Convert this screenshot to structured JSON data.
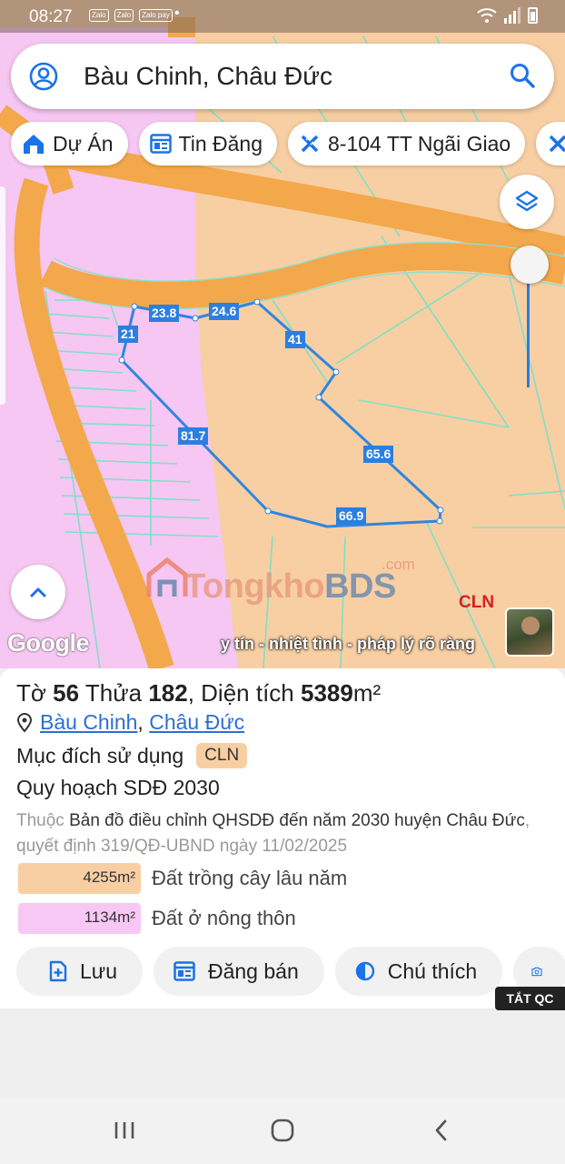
{
  "status_bar": {
    "time": "08:27",
    "app_icons": [
      "Zalo",
      "Zalo",
      "Zalo pay"
    ]
  },
  "search": {
    "value": "Bàu Chinh, Châu Đức",
    "placeholder": ""
  },
  "chips": [
    {
      "label": "Dự Án",
      "icon": "home-icon"
    },
    {
      "label": "Tin Đăng",
      "icon": "news-icon"
    },
    {
      "label": "8-104 TT Ngãi Giao",
      "icon": "tools-icon"
    }
  ],
  "map": {
    "dimensions": [
      "23.8",
      "24.6",
      "21",
      "41",
      "81.7",
      "65.6",
      "66.9"
    ],
    "zone_label": "CLN",
    "watermark": {
      "brand_orange": "Tongkho",
      "brand_blue": "BDS",
      "domain": ".com"
    },
    "google_logo": "Google",
    "tagline": "y tín - nhiệt tình - pháp lý rõ ràng",
    "colors": {
      "cln": "#f8cfa3",
      "ont": "#f6c7f2",
      "road": "#f3a84b",
      "boundary": "#2f86e0"
    }
  },
  "parcel": {
    "sheet_label": "Tờ",
    "sheet_no": "56",
    "lot_label": "Thửa",
    "lot_no": "182",
    "area_label": "Diện tích",
    "area": "5389",
    "area_unit": "m²",
    "commune": "Bàu Chinh",
    "district": "Châu Đức",
    "usage_label": "Mục đích sử dụng",
    "usage_code": "CLN",
    "plan_title": "Quy hoạch SDĐ 2030",
    "plan_prefix": "Thuộc",
    "plan_name": "Bản đồ điều chỉnh QHSDĐ đến năm 2030 huyện Châu Đức",
    "plan_decision": ", quyết định 319/QĐ-UBND ngày 11/02/2025",
    "areas": [
      {
        "value": "4255m²",
        "label": "Đất trồng cây lâu năm",
        "color": "#f8cfa3"
      },
      {
        "value": "1134m²",
        "label": "Đất ở nông thôn",
        "color": "#f8c8f4"
      }
    ]
  },
  "actions": [
    {
      "label": "Lưu",
      "icon": "bookmark-add-icon"
    },
    {
      "label": "Đăng bán",
      "icon": "news-icon"
    },
    {
      "label": "Chú thích",
      "icon": "contrast-icon"
    },
    {
      "label": "",
      "icon": "camera-add-icon"
    }
  ],
  "ad_close": "TẮT QC"
}
